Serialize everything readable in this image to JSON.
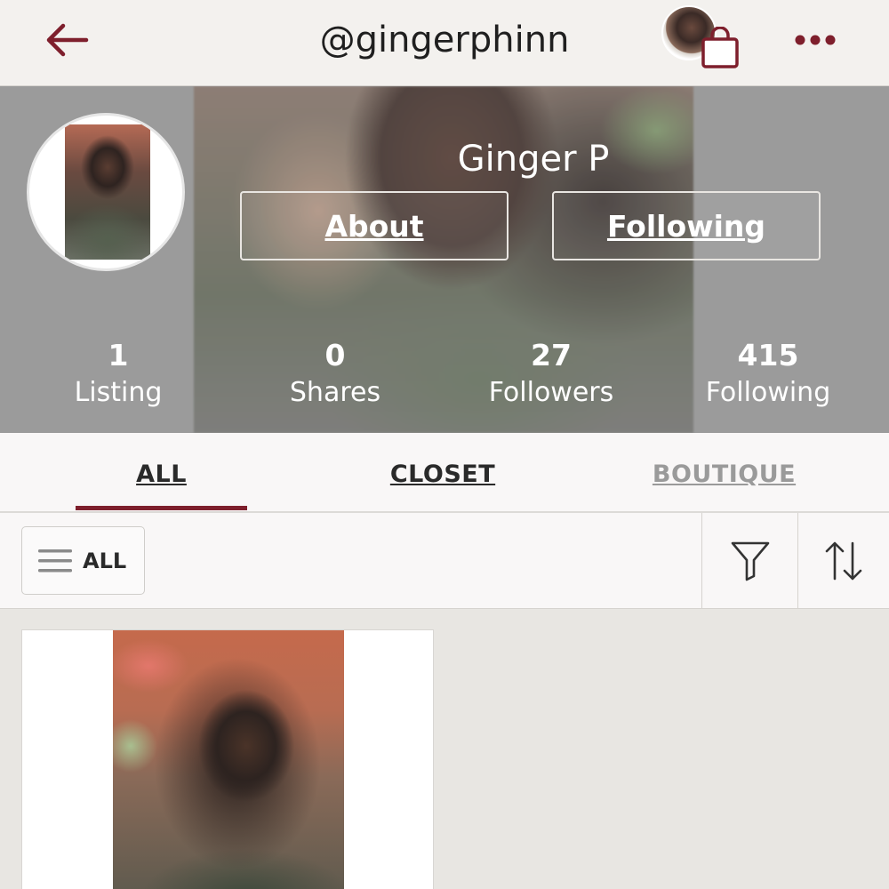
{
  "header": {
    "username": "@gingerphinn",
    "back_icon": "back-arrow-icon",
    "cart_icon": "shopping-bag-icon",
    "more_icon": "more-dots-icon",
    "accent_color": "#7e1f2c"
  },
  "profile": {
    "name": "Ginger P",
    "about_label": "About",
    "following_button_label": "Following"
  },
  "stats": [
    {
      "value": "1",
      "label": "Listing"
    },
    {
      "value": "0",
      "label": "Shares"
    },
    {
      "value": "27",
      "label": "Followers"
    },
    {
      "value": "415",
      "label": "Following"
    }
  ],
  "tabs": [
    {
      "label": "ALL",
      "active": true
    },
    {
      "label": "CLOSET",
      "active": false
    },
    {
      "label": "BOUTIQUE",
      "active": false
    }
  ],
  "filterbar": {
    "dropdown_label": "ALL",
    "menu_icon": "hamburger-menu-icon",
    "filter_icon": "filter-funnel-icon",
    "sort_icon": "sort-arrows-icon"
  }
}
